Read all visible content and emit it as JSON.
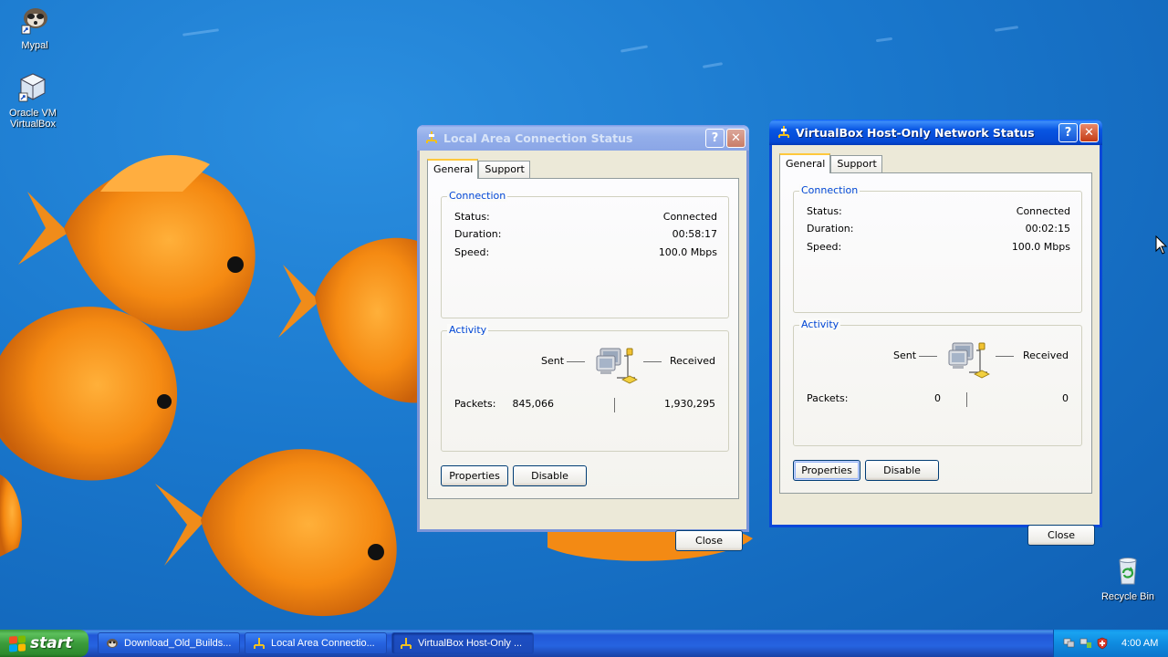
{
  "desktop": {
    "icons": [
      {
        "label": "Mypal",
        "icon": "mypal-raccoon-icon"
      },
      {
        "label": "Oracle VM VirtualBox",
        "icon": "virtualbox-cube-icon"
      },
      {
        "label": "Recycle Bin",
        "icon": "recycle-bin-icon"
      }
    ]
  },
  "window_lan": {
    "title": "Local Area Connection Status",
    "tabs": [
      "General",
      "Support"
    ],
    "selected_tab": "General",
    "connection": {
      "group_title": "Connection",
      "status_label": "Status:",
      "status_value": "Connected",
      "duration_label": "Duration:",
      "duration_value": "00:58:17",
      "speed_label": "Speed:",
      "speed_value": "100.0 Mbps"
    },
    "activity": {
      "group_title": "Activity",
      "sent_label": "Sent",
      "received_label": "Received",
      "packets_label": "Packets:",
      "packets_sent": "845,066",
      "packets_received": "1,930,295"
    },
    "buttons": {
      "properties": "Properties",
      "disable": "Disable",
      "close": "Close"
    },
    "active": false
  },
  "window_vbox": {
    "title": "VirtualBox Host-Only Network Status",
    "tabs": [
      "General",
      "Support"
    ],
    "selected_tab": "General",
    "connection": {
      "group_title": "Connection",
      "status_label": "Status:",
      "status_value": "Connected",
      "duration_label": "Duration:",
      "duration_value": "00:02:15",
      "speed_label": "Speed:",
      "speed_value": "100.0 Mbps"
    },
    "activity": {
      "group_title": "Activity",
      "sent_label": "Sent",
      "received_label": "Received",
      "packets_label": "Packets:",
      "packets_sent": "0",
      "packets_received": "0"
    },
    "buttons": {
      "properties": "Properties",
      "disable": "Disable",
      "close": "Close"
    },
    "active": true
  },
  "taskbar": {
    "start_label": "start",
    "tasks": [
      {
        "label": "Download_Old_Builds...",
        "icon": "mypal-raccoon-icon"
      },
      {
        "label": "Local Area Connectio...",
        "icon": "network-connection-icon"
      },
      {
        "label": "VirtualBox Host-Only ...",
        "icon": "network-connection-icon"
      }
    ],
    "clock": "4:00 AM"
  },
  "colors": {
    "titlebar_active": "#0548d3",
    "titlebar_inactive": "#8ba6e6",
    "desktop_bg": "#1774c7",
    "start_green": "#3b9b3b",
    "group_title_blue": "#0046d5"
  }
}
